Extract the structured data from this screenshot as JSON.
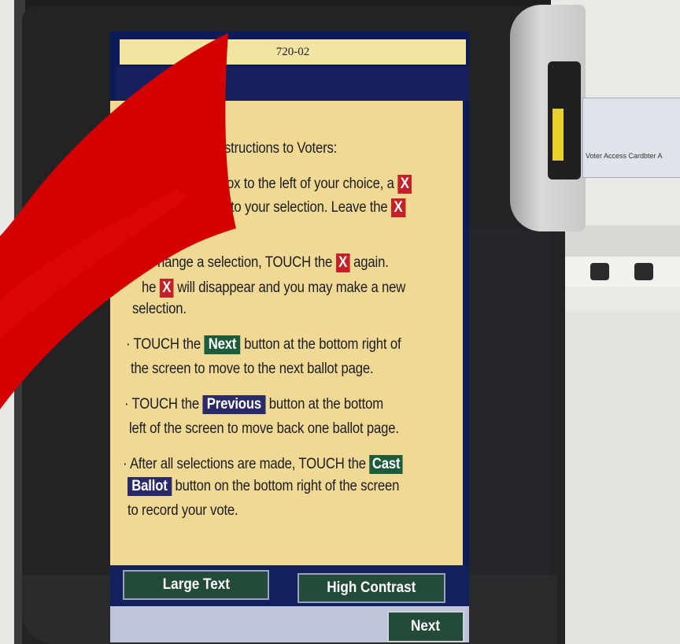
{
  "screen": {
    "header_code": "720-02"
  },
  "instructions": {
    "heading": "structions to Voters:",
    "line1_a": "ox to the left of your choice, a",
    "line2_a": "t to your selection.  Leave the",
    "line3_a": "hange a selection, TOUCH the",
    "line3_b": "again.",
    "line4_a": "he",
    "line4_b": "will disappear and you may make a new",
    "line5": "selection.",
    "line6_a": "· TOUCH the",
    "line6_b": "button at the bottom right of",
    "line7": "the screen to move to the next ballot page.",
    "line8_a": "· TOUCH the",
    "line8_b": "button at the bottom",
    "line9": "left of the screen to move back one ballot page.",
    "line10_a": "· After all selections are made, TOUCH the",
    "line11_b": "button on the bottom right of the screen",
    "line12": "to record your vote.",
    "x_mark": "X",
    "next_inline": "Next",
    "previous_inline": "Previous",
    "cast_inline": "Cast",
    "ballot_inline": "Ballot"
  },
  "buttons": {
    "large_text": "Large Text",
    "high_contrast": "High Contrast",
    "next": "Next"
  },
  "card": {
    "label": "Voter Access Card",
    "label_repeat": "bter A"
  },
  "colors": {
    "panel_bg": "#f0d994",
    "x_mark_red": "#c42027",
    "green_button": "#1d5c3a",
    "purple_button": "#2a2a6a",
    "overlay_red": "#d40000"
  }
}
